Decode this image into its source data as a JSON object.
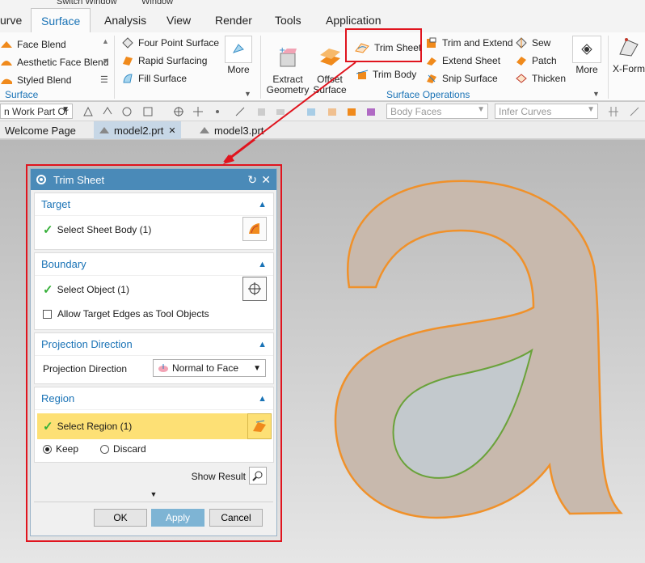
{
  "window_menu": {
    "switch_window": "Switch Window",
    "window": "Window"
  },
  "tabs": [
    "urve",
    "Surface",
    "Analysis",
    "View",
    "Render",
    "Tools",
    "Application"
  ],
  "ribbon": {
    "blend_items": [
      "Face Blend",
      "Aesthetic Face Blend",
      "Styled Blend"
    ],
    "blend_group": "Surface",
    "surface_items": [
      "Four Point Surface",
      "Rapid Surfacing",
      "Fill Surface"
    ],
    "more1": "More",
    "extract": "Extract\nGeometry",
    "offset": "Offset\nSurface",
    "trim_sheet": "Trim Sheet",
    "trim_body": "Trim Body",
    "ops_col1": [
      "Trim and Extend",
      "Extend Sheet",
      "Snip Surface"
    ],
    "ops_col2": [
      "Sew",
      "Patch",
      "Thicken"
    ],
    "more2": "More",
    "xform": "X-Form",
    "ops_group": "Surface Operations"
  },
  "toolbar": {
    "work_part": "n Work Part Or",
    "body_faces": "Body Faces",
    "infer_curves": "Infer Curves"
  },
  "doc_tabs": [
    {
      "label": "Welcome Page"
    },
    {
      "label": "model2.prt"
    },
    {
      "label": "model3.prt"
    }
  ],
  "dialog": {
    "title": "Trim Sheet",
    "target": {
      "header": "Target",
      "select": "Select Sheet Body (1)"
    },
    "boundary": {
      "header": "Boundary",
      "select": "Select Object (1)",
      "allow": "Allow Target Edges as Tool Objects"
    },
    "projection": {
      "header": "Projection Direction",
      "label": "Projection Direction",
      "value": "Normal to Face"
    },
    "region": {
      "header": "Region",
      "select": "Select Region (1)",
      "keep": "Keep",
      "discard": "Discard"
    },
    "show_result": "Show Result",
    "ok": "OK",
    "apply": "Apply",
    "cancel": "Cancel"
  },
  "colors": {
    "accent": "#1a73b6",
    "highlight": "#e0141e",
    "title_bar": "#4a8ab8",
    "region_row": "#fde075",
    "sheet_fill": "#c8b9ad",
    "sheet_edge": "#f0912a",
    "trim_curve": "#6aa23a"
  }
}
